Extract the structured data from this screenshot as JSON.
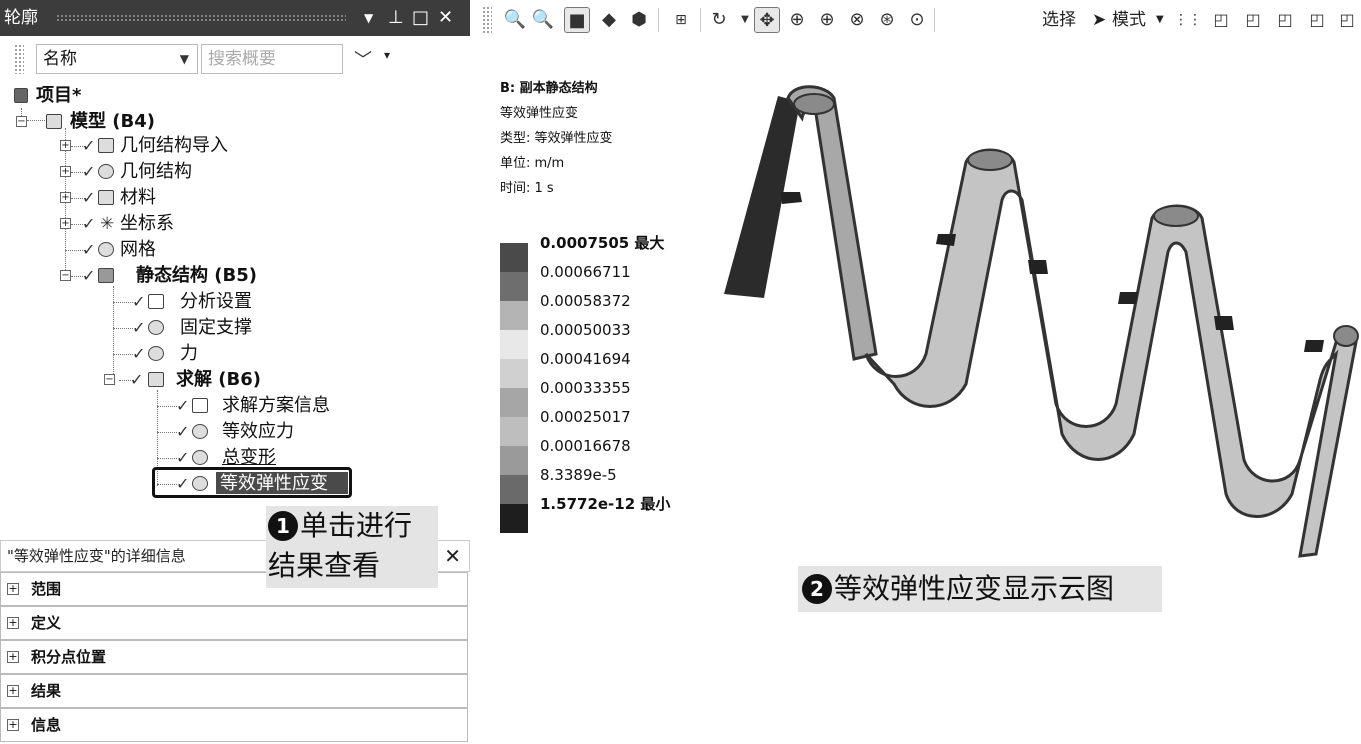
{
  "outline": {
    "title": "轮廓",
    "pin_icon": "pin-icon",
    "filter_label": "名称",
    "search_placeholder": "搜索概要",
    "tree": [
      {
        "label": "项目*",
        "bold": true
      },
      {
        "label": "模型 (B4)",
        "bold": true
      },
      {
        "label": "几何结构导入",
        "bold": false
      },
      {
        "label": "几何结构",
        "bold": false
      },
      {
        "label": "材料",
        "bold": false
      },
      {
        "label": "坐标系",
        "bold": false
      },
      {
        "label": "网格",
        "bold": false
      },
      {
        "label": "静态结构 (B5)",
        "bold": true
      },
      {
        "label": "分析设置",
        "bold": false
      },
      {
        "label": "固定支撑",
        "bold": false
      },
      {
        "label": "力",
        "bold": false
      },
      {
        "label": "求解 (B6)",
        "bold": true
      },
      {
        "label": "求解方案信息",
        "bold": false
      },
      {
        "label": "等效应力",
        "bold": false
      },
      {
        "label": "总变形",
        "bold": false
      },
      {
        "label": "等效弹性应变",
        "bold": false,
        "selected": true
      }
    ]
  },
  "details": {
    "title": "\"等效弹性应变\"的详细信息",
    "sections": [
      "范围",
      "定义",
      "积分点位置",
      "结果",
      "信息"
    ]
  },
  "toolbar": {
    "select_label": "选择",
    "mode_label": "模式"
  },
  "viewport": {
    "info": {
      "title": "B: 副本静态结构",
      "result": "等效弹性应变",
      "type": "类型: 等效弹性应变",
      "unit": "单位: m/m",
      "time": "时间: 1 s"
    },
    "legend": [
      {
        "value": "0.0007505 最大",
        "color": "#4a4a4a",
        "bold": true
      },
      {
        "value": "0.00066711",
        "color": "#6e6e6e",
        "bold": false
      },
      {
        "value": "0.00058372",
        "color": "#b4b4b4",
        "bold": false
      },
      {
        "value": "0.00050033",
        "color": "#e8e8e8",
        "bold": false
      },
      {
        "value": "0.00041694",
        "color": "#d0d0d0",
        "bold": false
      },
      {
        "value": "0.00033355",
        "color": "#a6a6a6",
        "bold": false
      },
      {
        "value": "0.00025017",
        "color": "#bebebe",
        "bold": false
      },
      {
        "value": "0.00016678",
        "color": "#9a9a9a",
        "bold": false
      },
      {
        "value": "8.3389e-5",
        "color": "#6a6a6a",
        "bold": false
      },
      {
        "value": "1.5772e-12 最小",
        "color": "#1e1e1e",
        "bold": true
      }
    ]
  },
  "annotations": {
    "callout_1_number": "1",
    "callout_1_line1": "单击进行",
    "callout_1_line2": "结果查看",
    "callout_2_number": "2",
    "callout_2_text": "等效弹性应变显示云图"
  }
}
